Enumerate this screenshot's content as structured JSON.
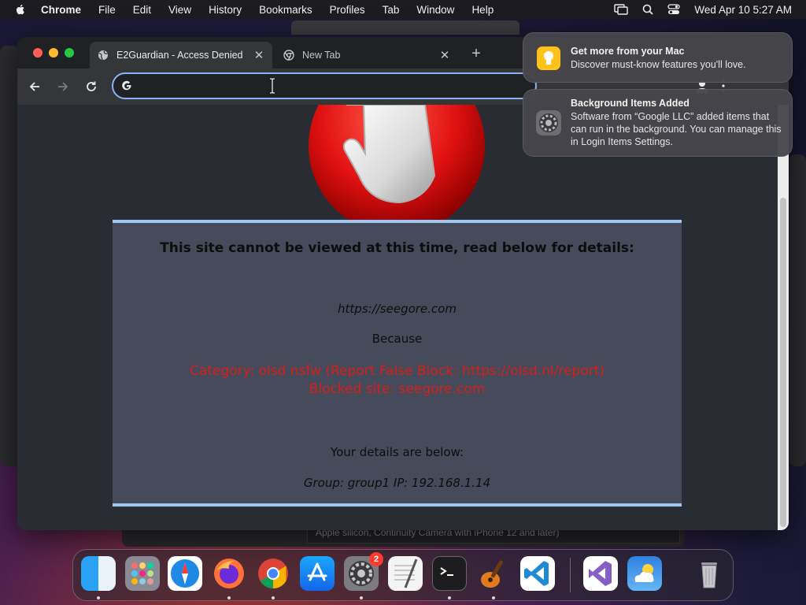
{
  "menubar": {
    "app_name": "Chrome",
    "items": [
      "File",
      "Edit",
      "View",
      "History",
      "Bookmarks",
      "Profiles",
      "Tab",
      "Window",
      "Help"
    ],
    "datetime": "Wed Apr 10  5:27 AM"
  },
  "background": {
    "camera_text": "Apple silicon, Continuity Camera with iPhone 12 and later)"
  },
  "chrome": {
    "tabs": [
      {
        "title": "E2Guardian - Access Denied",
        "active": true
      },
      {
        "title": "New Tab",
        "active": false
      }
    ],
    "omnibox": {
      "value": ""
    }
  },
  "page": {
    "headline": "This site cannot be viewed at this time, read below for details:",
    "url": "https://seegore.com",
    "because": "Because",
    "category": "Category: olsd nsfw (Report False Block: https://olsd.nl/report)",
    "blocked_site": "Blocked site: seegore.com",
    "details_heading": "Your details are below:",
    "group_ip": "Group: group1   IP: 192.168.1.14",
    "colors": {
      "panel": "#454b5a",
      "border": "#9cc8f3",
      "error_red": "#d91e18"
    }
  },
  "notifications": [
    {
      "title": "Get more from your Mac",
      "body": "Discover must-know features you'll love.",
      "icon": "tips-lightbulb-icon"
    },
    {
      "title": "Background Items Added",
      "body": "Software from “Google LLC” added items that can run in the background. You can manage this in Login Items Settings.",
      "icon": "system-settings-gear-icon"
    }
  ],
  "dock": {
    "items": [
      "Finder",
      "Launchpad",
      "Safari",
      "Firefox",
      "Google Chrome",
      "App Store",
      "System Settings",
      "TextEdit",
      "Terminal",
      "GarageBand",
      "Visual Studio Code",
      "Visual Studio",
      "Weather",
      "Trash"
    ],
    "badge_count": "2"
  }
}
